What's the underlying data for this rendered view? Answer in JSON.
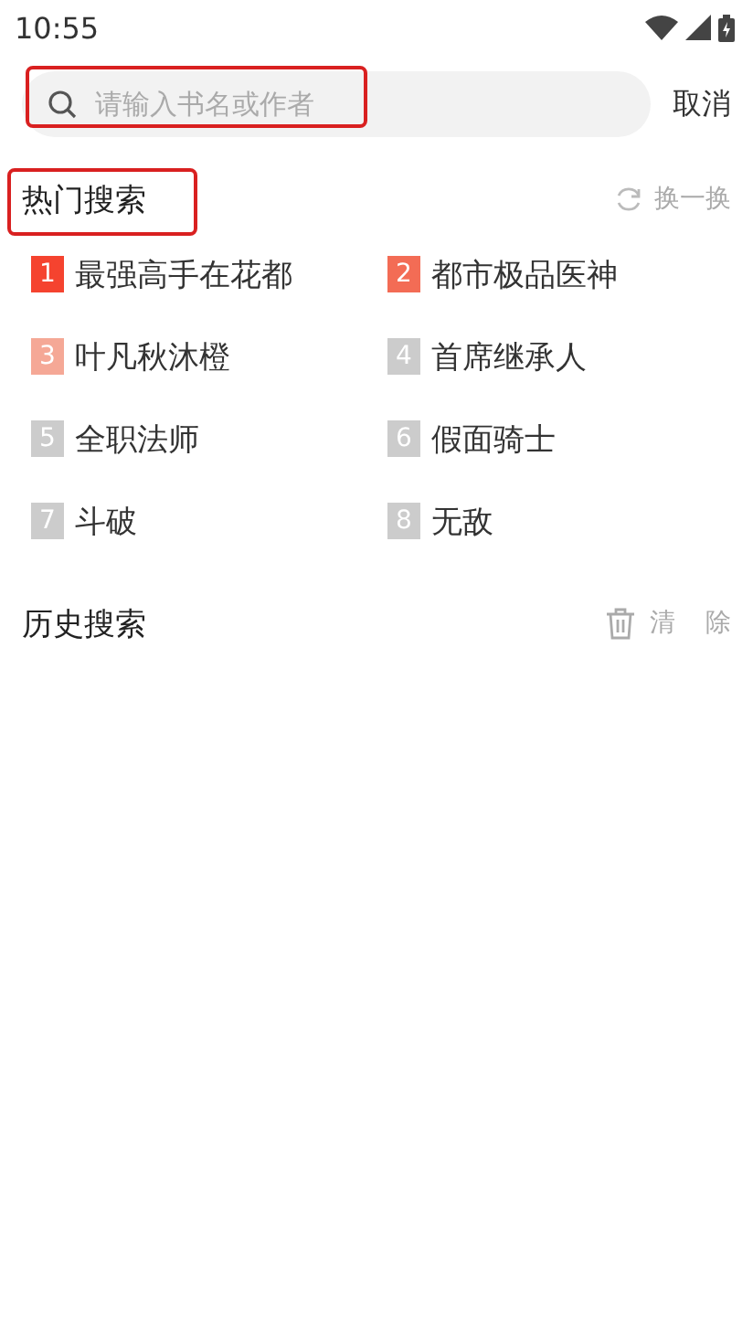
{
  "status_bar": {
    "time": "10:55"
  },
  "search": {
    "placeholder": "请输入书名或作者",
    "cancel": "取消"
  },
  "hot": {
    "title": "热门搜索",
    "refresh": "换一换",
    "items": [
      {
        "rank": "1",
        "label": "最强高手在花都",
        "color": "#f5432f"
      },
      {
        "rank": "2",
        "label": "都市极品医神",
        "color": "#f36c55"
      },
      {
        "rank": "3",
        "label": "叶凡秋沐橙",
        "color": "#f5a896"
      },
      {
        "rank": "4",
        "label": "首席继承人",
        "color": "#cccccc"
      },
      {
        "rank": "5",
        "label": "全职法师",
        "color": "#cccccc"
      },
      {
        "rank": "6",
        "label": "假面骑士",
        "color": "#cccccc"
      },
      {
        "rank": "7",
        "label": "斗破",
        "color": "#cccccc"
      },
      {
        "rank": "8",
        "label": "无敌",
        "color": "#cccccc"
      }
    ]
  },
  "history": {
    "title": "历史搜索",
    "clear": "清 除"
  }
}
